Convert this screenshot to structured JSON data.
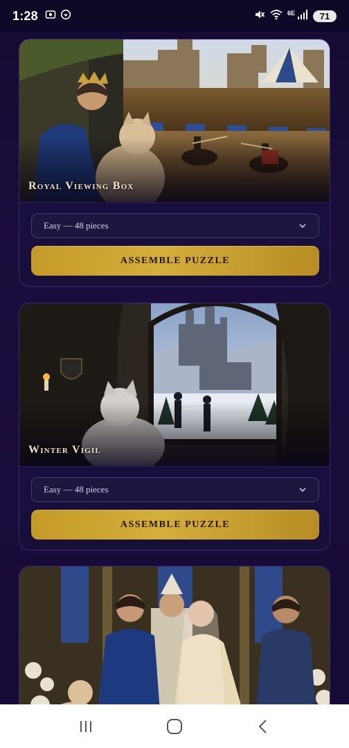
{
  "status_bar": {
    "time": "1:28",
    "network": "6E",
    "battery": "71",
    "left_icons": [
      "screenshot-icon",
      "vpn-shield-icon"
    ],
    "right_icons": [
      "mute-icon",
      "wifi-icon",
      "signal-icon"
    ]
  },
  "puzzles": [
    {
      "title": "Royal Viewing Box",
      "difficulty": "Easy — 48 pieces",
      "button_label": "Assemble Puzzle",
      "image_subject": "royal-jousting-tournament"
    },
    {
      "title": "Winter Vigil",
      "difficulty": "Easy — 48 pieces",
      "button_label": "Assemble Puzzle",
      "image_subject": "winter-castle-window"
    },
    {
      "title": "",
      "image_subject": "royal-wedding-ceremony"
    }
  ],
  "colors": {
    "background": "#1a0d3d",
    "card": "#1d1245",
    "button_gold": "#d4ae3b",
    "title_text": "#f3e6c4"
  },
  "nav_bar": {
    "buttons": [
      "recent-apps-icon",
      "home-icon",
      "back-icon"
    ]
  }
}
